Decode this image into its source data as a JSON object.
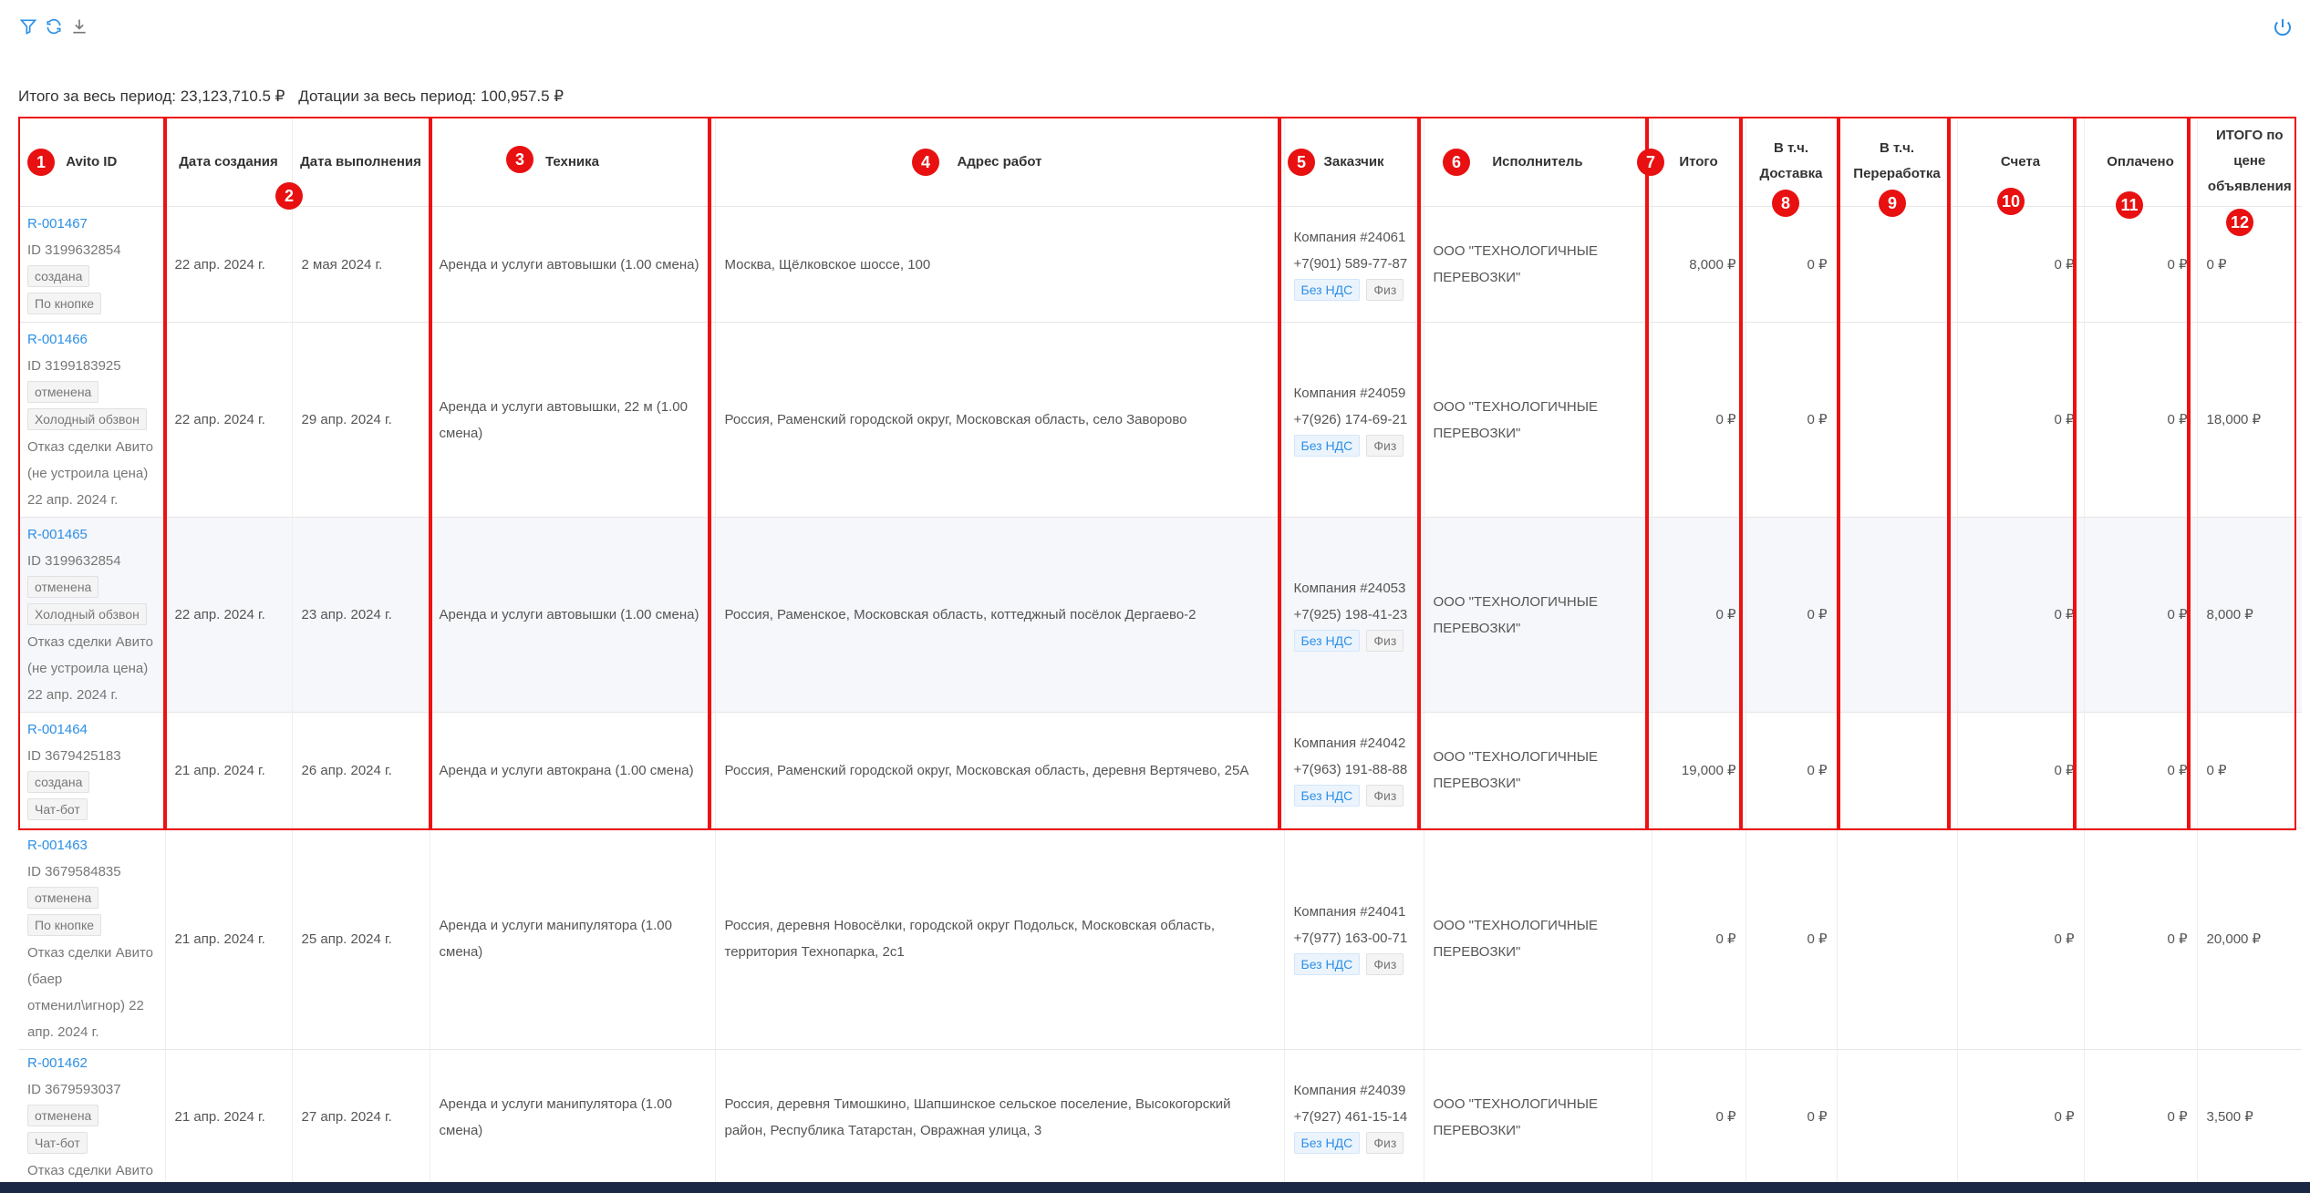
{
  "summary": {
    "total_label": "Итого за весь период:",
    "total_value": "23,123,710.5 ₽",
    "subsidy_label": "Дотации за весь период:",
    "subsidy_value": "100,957.5 ₽"
  },
  "toolbar": {
    "icons": [
      "filter-icon",
      "refresh-icon",
      "download-icon"
    ],
    "power_icon": "power-icon"
  },
  "columns": [
    {
      "label": "Avito ID"
    },
    {
      "label": "Дата создания"
    },
    {
      "label": "Дата выполнения"
    },
    {
      "label": "Техника"
    },
    {
      "label": "Адрес работ"
    },
    {
      "label": "Заказчик"
    },
    {
      "label": "Исполнитель"
    },
    {
      "label": "Итого"
    },
    {
      "label": "В т.ч. Доставка"
    },
    {
      "label": "В т.ч. Переработка"
    },
    {
      "label": "Счета"
    },
    {
      "label": "Оплачено"
    },
    {
      "label": "ИТОГО по цене объявления"
    }
  ],
  "markers": [
    "1",
    "2",
    "3",
    "4",
    "5",
    "6",
    "7",
    "8",
    "9",
    "10",
    "11",
    "12"
  ],
  "rows": [
    {
      "request": "R-001467",
      "id": "ID 3199632854",
      "status": "создана",
      "source": "По кнопке",
      "note": "",
      "created": "22 апр. 2024 г.",
      "done": "2 мая 2024 г.",
      "equipment": "Аренда и услуги автовышки (1.00 смена)",
      "address": "Москва, Щёлковское шоссе, 100",
      "customer": "Компания #24061",
      "phone": "+7(901) 589-77-87",
      "vat": "Без НДС",
      "type": "Физ",
      "executor": "ООО \"ТЕХНОЛОГИЧНЫЕ ПЕРЕВОЗКИ\"",
      "total": "8,000 ₽",
      "delivery": "0 ₽",
      "overtime": "",
      "invoices": "0 ₽",
      "paid": "0 ₽",
      "listing": "0 ₽"
    },
    {
      "request": "R-001466",
      "id": "ID 3199183925",
      "status": "отменена",
      "source": "Холодный обзвон",
      "note": "Отказ сделки Авито (не устроила цена) 22 апр. 2024 г.",
      "created": "22 апр. 2024 г.",
      "done": "29 апр. 2024 г.",
      "equipment": "Аренда и услуги автовышки, 22 м (1.00 смена)",
      "address": "Россия, Раменский городской округ, Московская область, село Заворово",
      "customer": "Компания #24059",
      "phone": "+7(926) 174-69-21",
      "vat": "Без НДС",
      "type": "Физ",
      "executor": "ООО \"ТЕХНОЛОГИЧНЫЕ ПЕРЕВОЗКИ\"",
      "total": "0 ₽",
      "delivery": "0 ₽",
      "overtime": "",
      "invoices": "0 ₽",
      "paid": "0 ₽",
      "listing": "18,000 ₽"
    },
    {
      "request": "R-001465",
      "id": "ID 3199632854",
      "status": "отменена",
      "source": "Холодный обзвон",
      "note": "Отказ сделки Авито (не устроила цена) 22 апр. 2024 г.",
      "created": "22 апр. 2024 г.",
      "done": "23 апр. 2024 г.",
      "equipment": "Аренда и услуги автовышки (1.00 смена)",
      "address": "Россия, Раменское, Московская область, коттеджный посёлок Дергаево-2",
      "customer": "Компания #24053",
      "phone": "+7(925) 198-41-23",
      "vat": "Без НДС",
      "type": "Физ",
      "executor": "ООО \"ТЕХНОЛОГИЧНЫЕ ПЕРЕВОЗКИ\"",
      "total": "0 ₽",
      "delivery": "0 ₽",
      "overtime": "",
      "invoices": "0 ₽",
      "paid": "0 ₽",
      "listing": "8,000 ₽"
    },
    {
      "request": "R-001464",
      "id": "ID 3679425183",
      "status": "создана",
      "source": "Чат-бот",
      "note": "",
      "created": "21 апр. 2024 г.",
      "done": "26 апр. 2024 г.",
      "equipment": "Аренда и услуги автокрана (1.00 смена)",
      "address": "Россия, Раменский городской округ, Московская область, деревня Вертячево, 25А",
      "customer": "Компания #24042",
      "phone": "+7(963) 191-88-88",
      "vat": "Без НДС",
      "type": "Физ",
      "executor": "ООО \"ТЕХНОЛОГИЧНЫЕ ПЕРЕВОЗКИ\"",
      "total": "19,000 ₽",
      "delivery": "0 ₽",
      "overtime": "",
      "invoices": "0 ₽",
      "paid": "0 ₽",
      "listing": "0 ₽"
    },
    {
      "request": "R-001463",
      "id": "ID 3679584835",
      "status": "отменена",
      "source": "По кнопке",
      "note": "Отказ сделки Авито (баер отменил\\игнор) 22 апр. 2024 г.",
      "created": "21 апр. 2024 г.",
      "done": "25 апр. 2024 г.",
      "equipment": "Аренда и услуги манипулятора (1.00 смена)",
      "address": "Россия, деревня Новосёлки, городской округ Подольск, Московская область, территория Технопарка, 2с1",
      "customer": "Компания #24041",
      "phone": "+7(977) 163-00-71",
      "vat": "Без НДС",
      "type": "Физ",
      "executor": "ООО \"ТЕХНОЛОГИЧНЫЕ ПЕРЕВОЗКИ\"",
      "total": "0 ₽",
      "delivery": "0 ₽",
      "overtime": "",
      "invoices": "0 ₽",
      "paid": "0 ₽",
      "listing": "20,000 ₽"
    },
    {
      "request": "R-001462",
      "id": "ID 3679593037",
      "status": "отменена",
      "source": "Чат-бот",
      "note": "Отказ сделки Авито",
      "created": "21 апр. 2024 г.",
      "done": "27 апр. 2024 г.",
      "equipment": "Аренда и услуги манипулятора (1.00 смена)",
      "address": "Россия, деревня Тимошкино, Шапшинское сельское поселение, Высокогорский район, Республика Татарстан, Овражная улица, 3",
      "customer": "Компания #24039",
      "phone": "+7(927) 461-15-14",
      "vat": "Без НДС",
      "type": "Физ",
      "executor": "ООО \"ТЕХНОЛОГИЧНЫЕ ПЕРЕВОЗКИ\"",
      "total": "0 ₽",
      "delivery": "0 ₽",
      "overtime": "",
      "invoices": "0 ₽",
      "paid": "0 ₽",
      "listing": "3,500 ₽"
    }
  ]
}
